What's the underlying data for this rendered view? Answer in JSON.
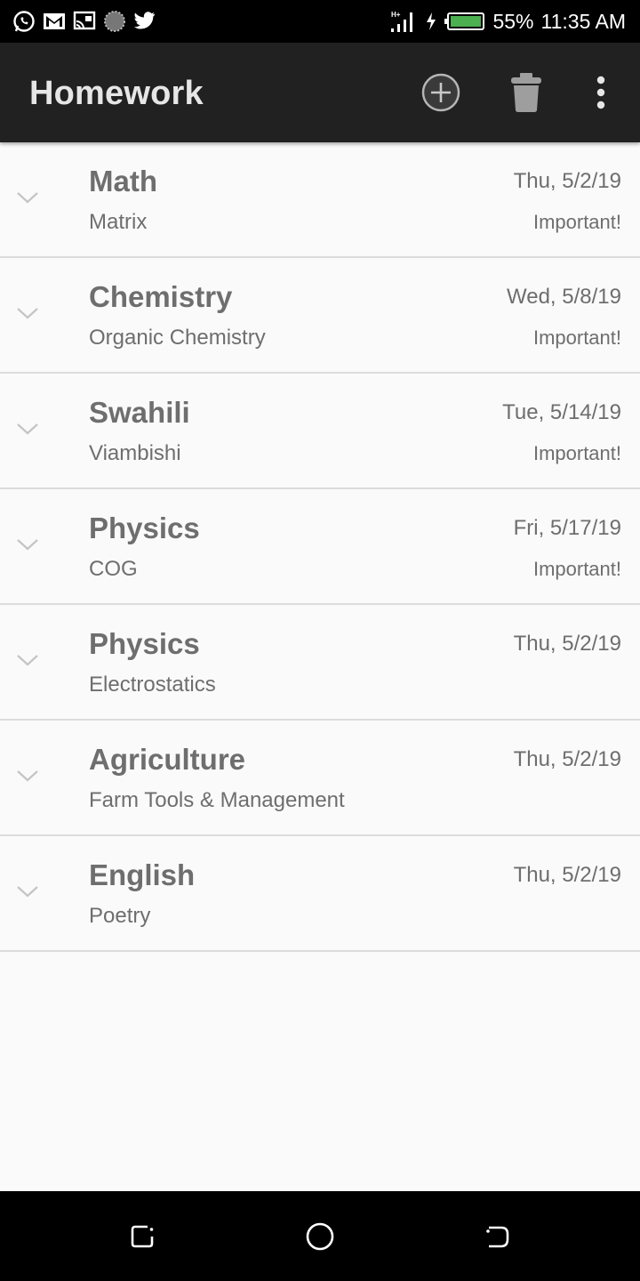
{
  "status_bar": {
    "notification_icons": [
      "whatsapp-icon",
      "gmail-icon",
      "cast-icon",
      "loading-icon",
      "twitter-icon"
    ],
    "network_label": "H+",
    "battery_percent": "55%",
    "time": "11:35 AM"
  },
  "app_bar": {
    "title": "Homework",
    "actions": [
      "add-circle-icon",
      "trash-icon",
      "more-vert-icon"
    ]
  },
  "homework": [
    {
      "subject": "Math",
      "topic": "Matrix",
      "date": "Thu, 5/2/19",
      "flag": "Important!"
    },
    {
      "subject": "Chemistry",
      "topic": "Organic Chemistry",
      "date": "Wed, 5/8/19",
      "flag": "Important!"
    },
    {
      "subject": "Swahili",
      "topic": "Viambishi",
      "date": "Tue, 5/14/19",
      "flag": "Important!"
    },
    {
      "subject": "Physics",
      "topic": "COG",
      "date": "Fri, 5/17/19",
      "flag": "Important!"
    },
    {
      "subject": "Physics",
      "topic": "Electrostatics",
      "date": "Thu, 5/2/19",
      "flag": ""
    },
    {
      "subject": "Agriculture",
      "topic": "Farm Tools & Management",
      "date": "Thu, 5/2/19",
      "flag": ""
    },
    {
      "subject": "English",
      "topic": "Poetry",
      "date": "Thu, 5/2/19",
      "flag": ""
    }
  ],
  "nav_bar": {
    "buttons": [
      "recent-apps-icon",
      "home-icon",
      "back-icon"
    ]
  },
  "colors": {
    "app_bar": "#212121",
    "background": "#fafafa",
    "text": "#6e6e6e",
    "battery": "#4caf50",
    "divider": "#dcdcdc"
  }
}
